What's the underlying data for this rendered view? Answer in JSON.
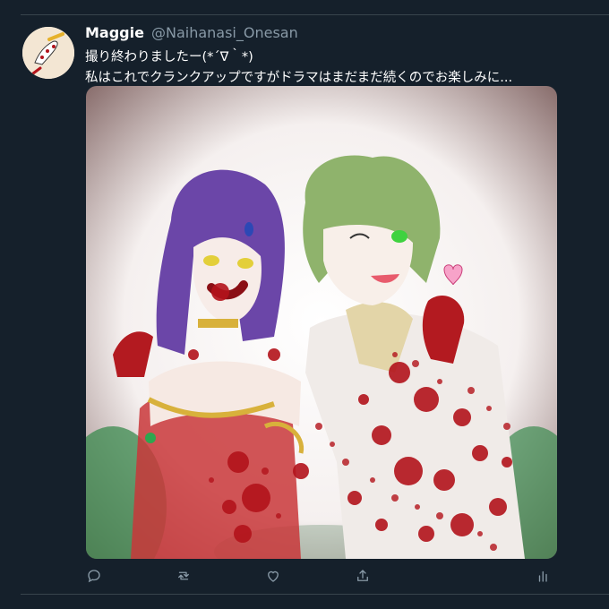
{
  "tweet": {
    "display_name": "Maggie",
    "handle": "@Naihanasi_Onesan",
    "text_line1": "撮り終わりましたー(*´∇｀*)",
    "text_line2": "私はこれでクランクアップですがドラマはまだまだ続くのでお楽しみに..."
  },
  "actions": [
    {
      "name": "reply",
      "icon": "reply-icon"
    },
    {
      "name": "retweet",
      "icon": "retweet-icon"
    },
    {
      "name": "like",
      "icon": "heart-icon"
    },
    {
      "name": "share",
      "icon": "share-icon"
    },
    {
      "name": "analytics",
      "icon": "analytics-icon"
    }
  ],
  "colors": {
    "background": "#15202b",
    "text": "#ffffff",
    "muted": "#8899a6",
    "divider": "#38444d"
  }
}
